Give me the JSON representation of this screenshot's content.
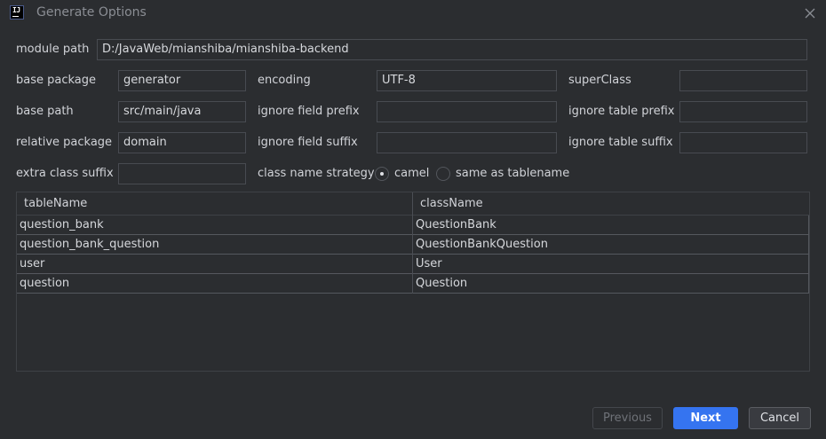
{
  "window": {
    "title": "Generate Options",
    "icon_text": "IJ"
  },
  "form": {
    "module_path": {
      "label": "module path",
      "value": "D:/JavaWeb/mianshiba/mianshiba-backend"
    },
    "base_package": {
      "label": "base package",
      "value": "generator"
    },
    "encoding": {
      "label": "encoding",
      "value": "UTF-8"
    },
    "super_class": {
      "label": "superClass",
      "value": ""
    },
    "base_path": {
      "label": "base path",
      "value": "src/main/java"
    },
    "ignore_field_prefix": {
      "label": "ignore field prefix",
      "value": ""
    },
    "ignore_table_prefix": {
      "label": "ignore table prefix",
      "value": ""
    },
    "relative_package": {
      "label": "relative package",
      "value": "domain"
    },
    "ignore_field_suffix": {
      "label": "ignore field suffix",
      "value": ""
    },
    "ignore_table_suffix": {
      "label": "ignore table suffix",
      "value": ""
    },
    "extra_class_suffix": {
      "label": "extra class suffix",
      "value": ""
    },
    "class_name_strategy": {
      "label": "class name strategy",
      "options": [
        "camel",
        "same as tablename"
      ],
      "selected": "camel"
    }
  },
  "table": {
    "headers": [
      "tableName",
      "className"
    ],
    "rows": [
      [
        "question_bank",
        "QuestionBank"
      ],
      [
        "question_bank_question",
        "QuestionBankQuestion"
      ],
      [
        "user",
        "User"
      ],
      [
        "question",
        "Question"
      ]
    ]
  },
  "buttons": {
    "previous": "Previous",
    "next": "Next",
    "cancel": "Cancel"
  },
  "colors": {
    "background": "#2b2d30",
    "primary": "#3574f0",
    "border": "#484b51"
  }
}
